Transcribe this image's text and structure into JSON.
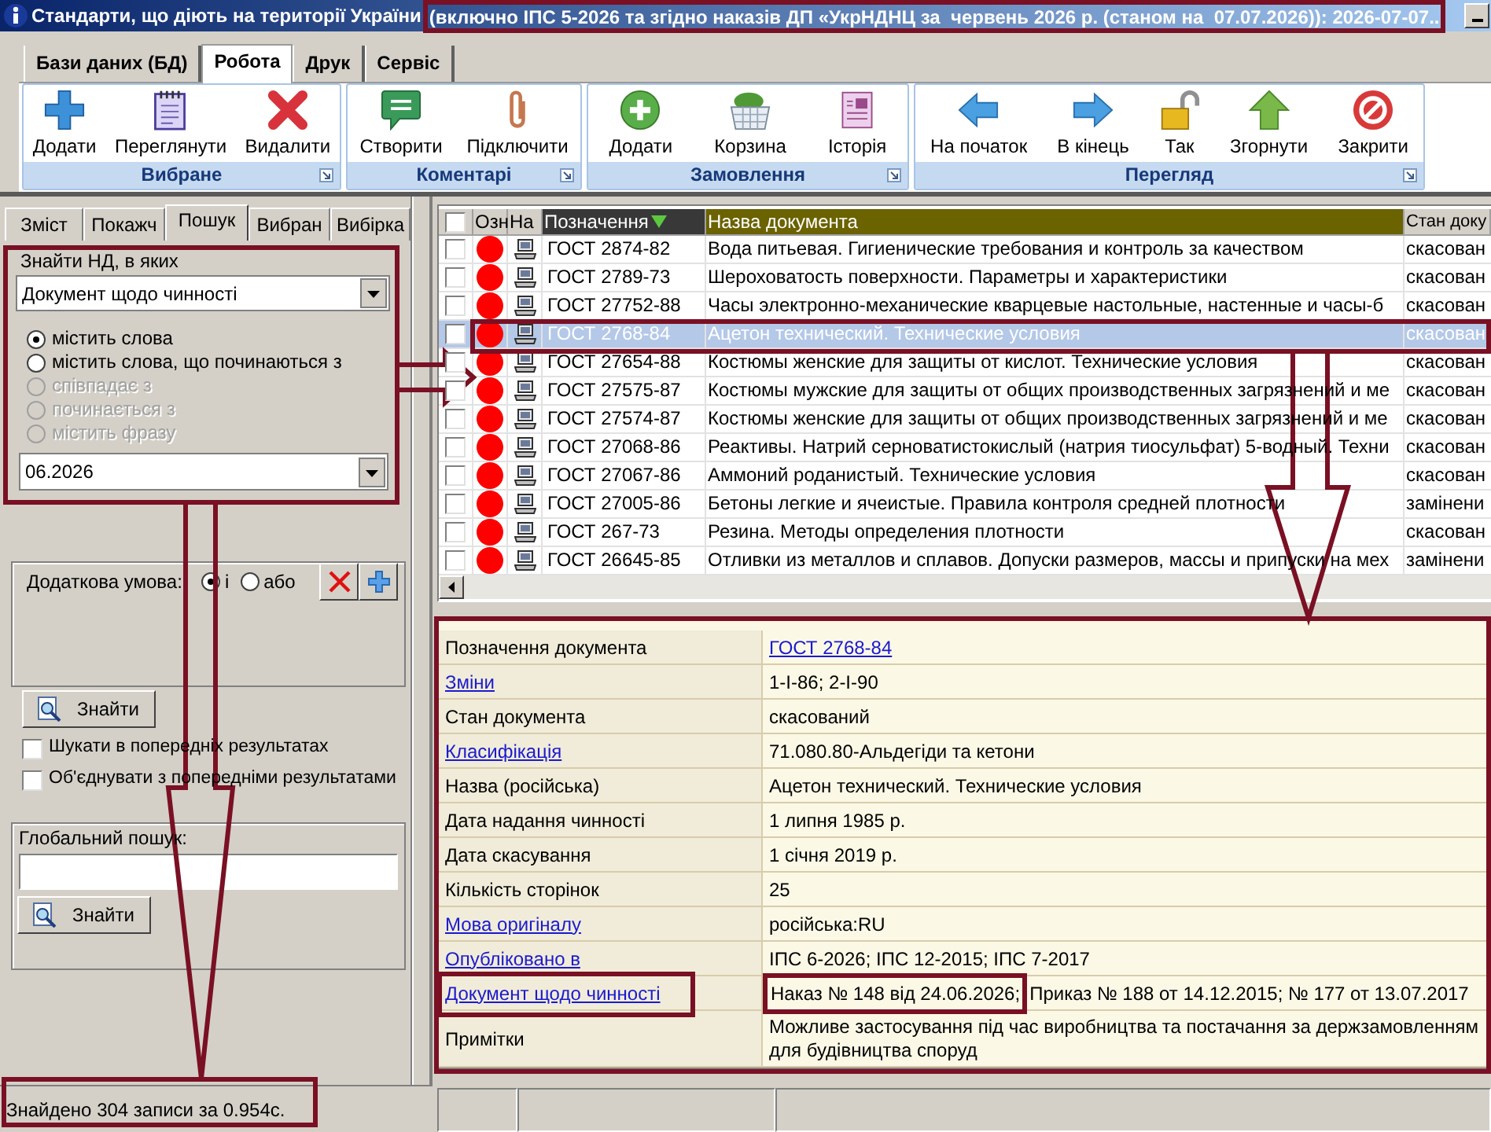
{
  "window": {
    "title_parts": [
      {
        "text": "Стандарти, що діють на території України",
        "framed": false
      },
      {
        "text": "(включно ІПС 5-2026 та згідно наказів ДП «УкрНДНЦ за  червень 2026 р. (станом на  07.07.2026)): 2026-07-07..",
        "framed": true
      }
    ]
  },
  "ribbon": {
    "tabs": [
      {
        "label": "Бази даних (БД)",
        "selected": false
      },
      {
        "label": "Робота",
        "selected": true
      },
      {
        "label": "Друк",
        "selected": false
      },
      {
        "label": "Сервіс",
        "selected": false
      }
    ],
    "groups": [
      {
        "title": "Вибране",
        "buttons": [
          {
            "label": "Додати",
            "kind": "plus"
          },
          {
            "label": "Переглянути",
            "kind": "notepad"
          },
          {
            "label": "Видалити",
            "kind": "cross"
          }
        ]
      },
      {
        "title": "Коментарі",
        "buttons": [
          {
            "label": "Створити",
            "kind": "bubble"
          },
          {
            "label": "Підключити",
            "kind": "paperclip"
          }
        ]
      },
      {
        "title": "Замовлення",
        "buttons": [
          {
            "label": "Додати",
            "kind": "pluscircle"
          },
          {
            "label": "Корзина",
            "kind": "basket"
          },
          {
            "label": "Історія",
            "kind": "document"
          }
        ]
      },
      {
        "title": "Перегляд",
        "buttons": [
          {
            "label": "На початок",
            "kind": "left"
          },
          {
            "label": "В кінець",
            "kind": "right"
          },
          {
            "label": "Так",
            "kind": "padlock"
          },
          {
            "label": "Згорнути",
            "kind": "up"
          },
          {
            "label": "Закрити",
            "kind": "prohibit"
          }
        ]
      }
    ]
  },
  "left_panel": {
    "tabs": [
      {
        "label": "Зміст",
        "selected": false
      },
      {
        "label": "Покажч",
        "selected": false
      },
      {
        "label": "Пошук",
        "selected": true
      },
      {
        "label": "Вибран",
        "selected": false
      },
      {
        "label": "Вибірка",
        "selected": false
      }
    ],
    "search": {
      "label": "Знайти НД, в яких",
      "field": "Документ щодо чинності",
      "modes": [
        {
          "label": "містить слова",
          "selected": true,
          "disabled": false
        },
        {
          "label": "містить слова, що починаються з",
          "selected": false,
          "disabled": false
        },
        {
          "label": "співпадає з",
          "selected": false,
          "disabled": true
        },
        {
          "label": "починається з",
          "selected": false,
          "disabled": true
        },
        {
          "label": "містить фразу",
          "selected": false,
          "disabled": true
        }
      ],
      "value": "06.2026"
    },
    "extra_condition": {
      "label": "Додаткова умова:",
      "options": [
        {
          "label": "і",
          "selected": true
        },
        {
          "label": "або",
          "selected": false
        }
      ]
    },
    "find_button": "Знайти",
    "options": [
      {
        "label": "Шукати в попередніх результатах",
        "checked": false
      },
      {
        "label": "Об'єднувати з попередніми результатами",
        "checked": false
      }
    ],
    "global_search": {
      "label": "Глобальний пошук:",
      "button": "Знайти"
    }
  },
  "table": {
    "select_all": {
      "checked": false
    },
    "columns": [
      {
        "label": "Озн",
        "sorted": false
      },
      {
        "label": "На",
        "sorted": false
      },
      {
        "label": "Позначення",
        "sorted": true
      },
      {
        "label": "Назва документа",
        "sorted": false,
        "color": "#6b6200"
      },
      {
        "label": "Стан доку",
        "sorted": false
      }
    ],
    "rows": [
      {
        "checked": false,
        "color": "#ff0000",
        "designation": "ГОСТ 2874-82",
        "name": "Вода питьевая. Гигиенические требования и контроль за качеством",
        "status": "скасован",
        "selected": false
      },
      {
        "checked": false,
        "color": "#ff0000",
        "designation": "ГОСТ 2789-73",
        "name": "Шероховатость поверхности. Параметры и характеристики",
        "status": "скасован",
        "selected": false
      },
      {
        "checked": false,
        "color": "#ff0000",
        "designation": "ГОСТ 27752-88",
        "name": "Часы электронно-механические кварцевые настольные, настенные и часы-б",
        "status": "скасован",
        "selected": false
      },
      {
        "checked": false,
        "color": "#ff0000",
        "designation": "ГОСТ 2768-84",
        "name": "Ацетон технический. Технические условия",
        "status": "скасован",
        "selected": true
      },
      {
        "checked": false,
        "color": "#ff0000",
        "designation": "ГОСТ 27654-88",
        "name": "Костюмы женские для защиты от кислот. Технические условия",
        "status": "скасован",
        "selected": false
      },
      {
        "checked": false,
        "color": "#ff0000",
        "designation": "ГОСТ 27575-87",
        "name": "Костюмы мужские для защиты от общих производственных загрязнений и ме",
        "status": "скасован",
        "selected": false
      },
      {
        "checked": false,
        "color": "#ff0000",
        "designation": "ГОСТ 27574-87",
        "name": "Костюмы женские для защиты от общих производственных загрязнений и ме",
        "status": "скасован",
        "selected": false
      },
      {
        "checked": false,
        "color": "#ff0000",
        "designation": "ГОСТ 27068-86",
        "name": "Реактивы. Натрий серноватистокислый (натрия тиосульфат) 5-водный. Техни",
        "status": "скасован",
        "selected": false
      },
      {
        "checked": false,
        "color": "#ff0000",
        "designation": "ГОСТ 27067-86",
        "name": "Аммоний роданистый. Технические условия",
        "status": "скасован",
        "selected": false
      },
      {
        "checked": false,
        "color": "#ff0000",
        "designation": "ГОСТ 27005-86",
        "name": "Бетоны легкие и ячеистые. Правила контроля средней плотности",
        "status": "замінени",
        "selected": false
      },
      {
        "checked": false,
        "color": "#ff0000",
        "designation": "ГОСТ 267-73",
        "name": "Резина. Методы определения плотности",
        "status": "скасован",
        "selected": false
      },
      {
        "checked": false,
        "color": "#ff0000",
        "designation": "ГОСТ 26645-85",
        "name": "Отливки из металлов и сплавов. Допуски размеров, массы и припуски на мех",
        "status": "замінени",
        "selected": false
      }
    ]
  },
  "details": [
    {
      "label": "Позначення документа",
      "label_link": false,
      "value": "ГОСТ 2768-84",
      "value_link": true
    },
    {
      "label": "Зміни",
      "label_link": true,
      "value": "1-I-86; 2-I-90",
      "value_link": false
    },
    {
      "label": "Стан документа",
      "label_link": false,
      "value": "скасований",
      "value_link": false
    },
    {
      "label": "Класифікація",
      "label_link": true,
      "value": "71.080.80-Альдегіди та кетони",
      "value_link": false
    },
    {
      "label": "Назва (російська)",
      "label_link": false,
      "value": "Ацетон технический. Технические условия",
      "value_link": false
    },
    {
      "label": "Дата надання чинності",
      "label_link": false,
      "value": "1 липня 1985 р.",
      "value_link": false
    },
    {
      "label": "Дата скасування",
      "label_link": false,
      "value": "1 січня 2019 р.",
      "value_link": false
    },
    {
      "label": "Кількість сторінок",
      "label_link": false,
      "value": "25",
      "value_link": false
    },
    {
      "label": "Мова оригіналу",
      "label_link": true,
      "value": "російська:RU",
      "value_link": false
    },
    {
      "label": "Опубліковано в",
      "label_link": true,
      "value": "ІПС 6-2026; ІПС 12-2015; ІПС 7-2017",
      "value_link": false
    },
    {
      "label": "Документ щодо чинності",
      "label_link": true,
      "value_parts": [
        {
          "text": "Наказ № 148 від 24.06.2026;",
          "framed": true
        },
        {
          "text": "Приказ № 188 от 14.12.2015; № 177 от 13.07.2017",
          "framed": false
        }
      ],
      "value_link": false
    },
    {
      "label": "Примітки",
      "label_link": false,
      "value": "Можливе застосування під час виробництва та постачання за держзамовленням для будівництва споруд",
      "value_link": false
    }
  ],
  "status_bar": {
    "text": "Знайдено 304 записи за 0.954с."
  }
}
